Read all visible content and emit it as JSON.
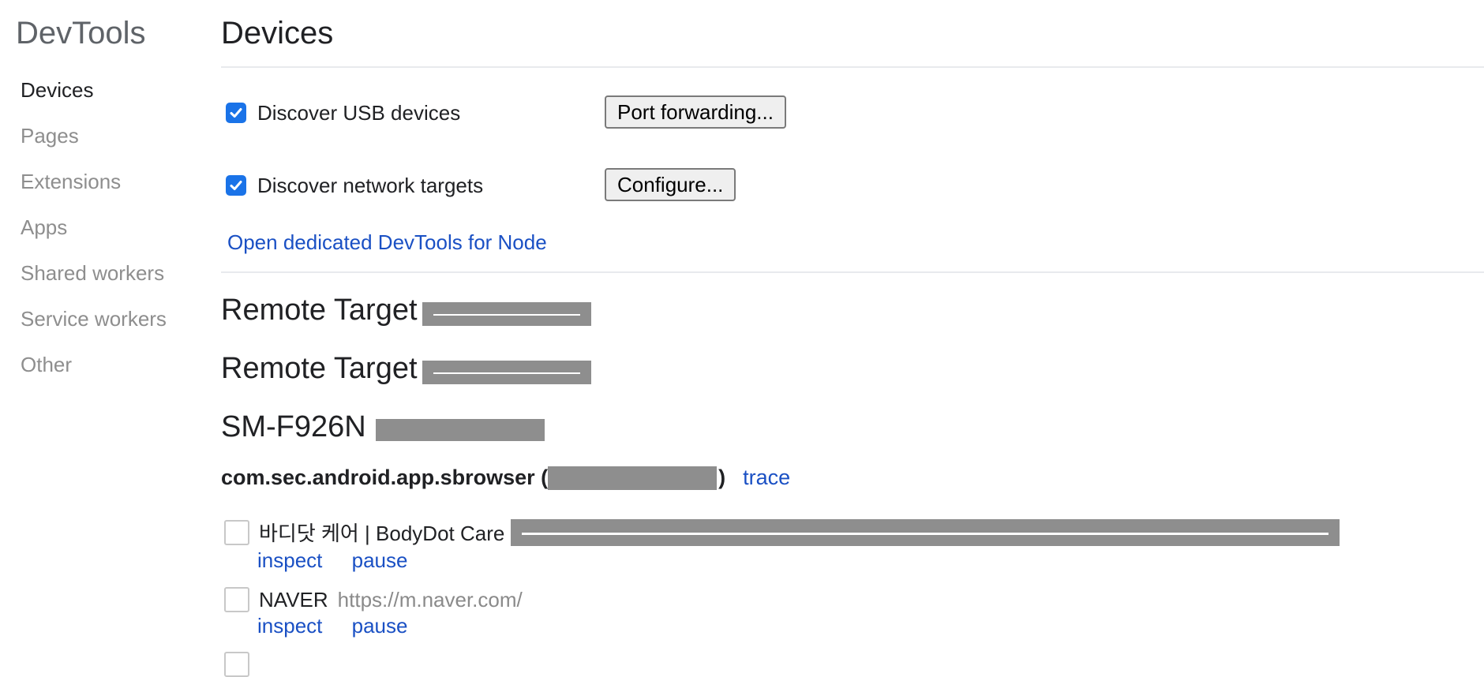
{
  "app_title": "DevTools",
  "sidebar": {
    "items": [
      {
        "label": "Devices"
      },
      {
        "label": "Pages"
      },
      {
        "label": "Extensions"
      },
      {
        "label": "Apps"
      },
      {
        "label": "Shared workers"
      },
      {
        "label": "Service workers"
      },
      {
        "label": "Other"
      }
    ],
    "active": "Devices"
  },
  "main": {
    "title": "Devices",
    "discover_usb": {
      "label": "Discover USB devices",
      "checked": true,
      "button": "Port forwarding..."
    },
    "discover_network": {
      "label": "Discover network targets",
      "checked": true,
      "button": "Configure..."
    },
    "node_link": "Open dedicated DevTools for Node",
    "remote_targets": [
      {
        "label": "Remote Target"
      },
      {
        "label": "Remote Target"
      }
    ],
    "device": {
      "model": "SM-F926N",
      "package": {
        "name": "com.sec.android.app.sbrowser (",
        "close_paren": ")",
        "trace": "trace"
      },
      "targets": [
        {
          "title": "바디닷 케어 | BodyDot Care",
          "url": "",
          "inspect": "inspect",
          "pause": "pause"
        },
        {
          "title": "NAVER",
          "url": "https://m.naver.com/",
          "inspect": "inspect",
          "pause": "pause"
        }
      ]
    }
  },
  "colors": {
    "accent": "#1a73e8",
    "link": "#1a50c4",
    "redaction": "#8e8e8e",
    "muted_text": "#8e8e8e"
  }
}
